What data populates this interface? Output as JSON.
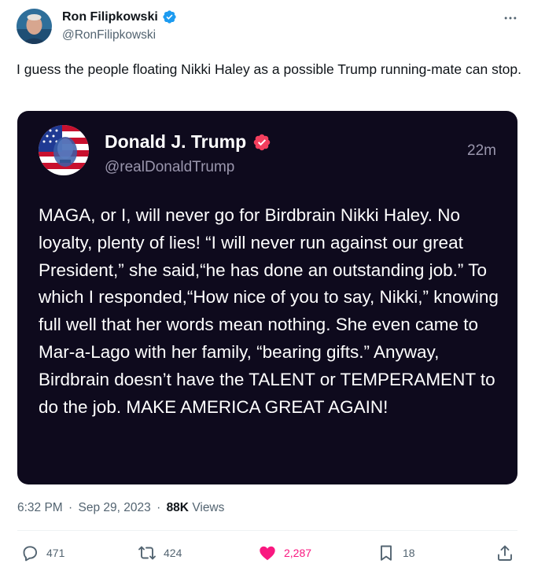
{
  "author": {
    "display_name": "Ron Filipkowski",
    "handle": "@RonFilipkowski"
  },
  "tweet_text": "I guess the people floating Nikki Haley as a possible Trump running-mate can stop.",
  "embedded_post": {
    "display_name": "Donald J. Trump",
    "handle": "@realDonaldTrump",
    "time_ago": "22m",
    "body": "MAGA, or I, will never go for Birdbrain Nikki Haley. No loyalty, plenty of lies! “I will never run against our great President,” she said,“he has done an outstanding job.” To which I responded,“How nice of you to say, Nikki,” knowing full well that her words mean nothing. She even came to Mar-a-Lago with her family, “bearing gifts.” Anyway, Birdbrain doesn’t have the TALENT or TEMPERAMENT to do the job. MAKE AMERICA GREAT AGAIN!"
  },
  "meta": {
    "time": "6:32 PM",
    "date": "Sep 29, 2023",
    "separator": "·",
    "views_count": "88K",
    "views_label": "Views"
  },
  "actions": {
    "replies": "471",
    "reposts": "424",
    "likes": "2,287",
    "bookmarks": "18"
  },
  "icons": {
    "verified": "verified-badge-icon",
    "more": "more-horizontal-icon",
    "reply": "reply-bubble-icon",
    "repost": "repost-arrows-icon",
    "like": "heart-icon",
    "bookmark": "bookmark-icon",
    "share": "share-upload-icon"
  },
  "colors": {
    "verified": "#1d9bf0",
    "like": "#f91880",
    "card_bg": "#0e0a1d",
    "card_badge": "#f43f5e",
    "muted": "#536471"
  }
}
